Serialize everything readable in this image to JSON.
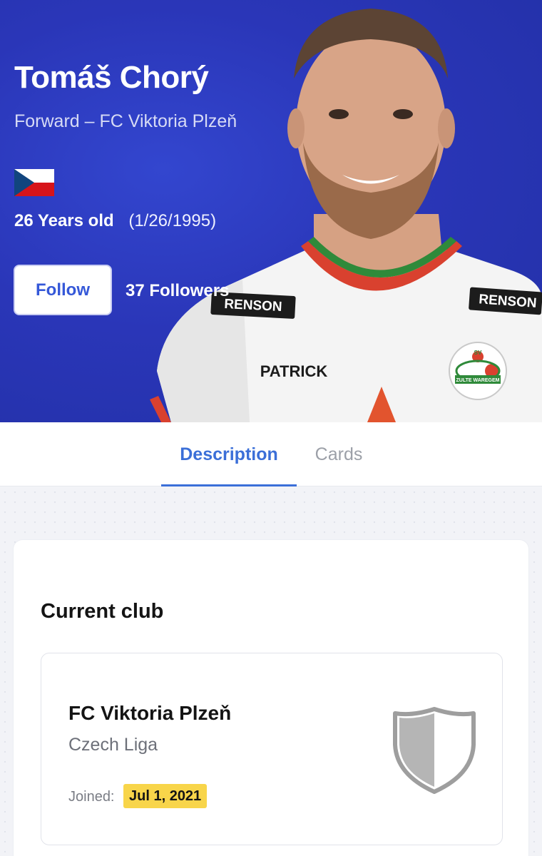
{
  "player": {
    "name": "Tomáš Chorý",
    "position_club": "Forward – FC Viktoria Plzeň",
    "nationality_flag": "czech-republic",
    "age": "26 Years old",
    "dob": "(1/26/1995)",
    "follow_label": "Follow",
    "followers": "37 Followers"
  },
  "shirt": {
    "sponsor_left": "RENSON",
    "sponsor_right": "RENSON",
    "brand": "PATRICK",
    "badge_top": "SV",
    "badge_text": "ZULTE WAREGEM"
  },
  "tabs": [
    {
      "label": "Description",
      "active": true
    },
    {
      "label": "Cards",
      "active": false
    }
  ],
  "current_club": {
    "section_title": "Current club",
    "club_name": "FC Viktoria Plzeň",
    "league": "Czech Liga",
    "joined_label": "Joined:",
    "joined_date": "Jul 1, 2021",
    "crest_icon": "shield-icon"
  },
  "colors": {
    "hero_bg": "#2a36b8",
    "accent": "#3b6fd8",
    "highlight": "#f8d54a"
  }
}
